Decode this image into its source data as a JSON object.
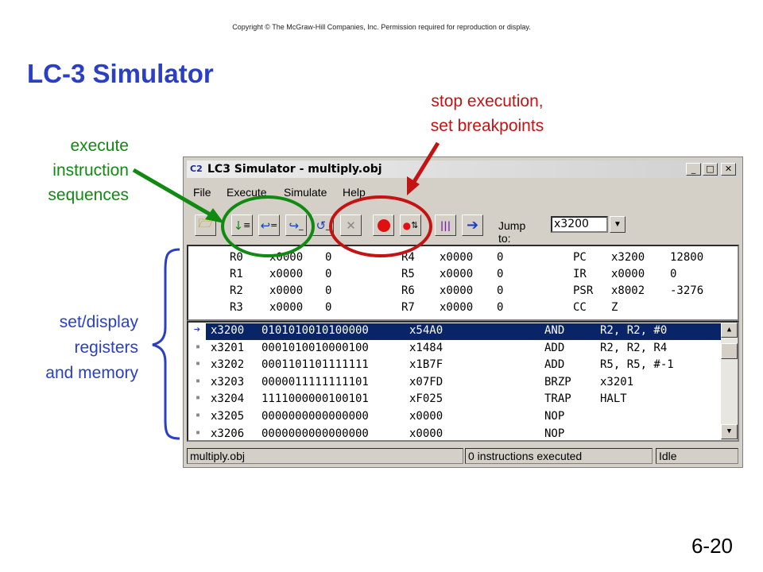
{
  "copyright": "Copyright © The McGraw-Hill Companies, Inc.  Permission required for reproduction or display.",
  "slide_title": "LC-3 Simulator",
  "slide_number": "6-20",
  "annotations": {
    "execute": [
      "execute",
      "instruction",
      "sequences"
    ],
    "stop": [
      "stop execution,",
      "set breakpoints"
    ],
    "display": [
      "set/display",
      "registers",
      "and memory"
    ]
  },
  "colors": {
    "green": "#118a11",
    "red": "#c41313",
    "blue": "#2b3fc4",
    "selection": "#0a2468"
  },
  "window": {
    "icon_text": "C2",
    "title": "LC3 Simulator - multiply.obj",
    "controls": [
      "_",
      "□",
      "✕"
    ],
    "menu": [
      "File",
      "Execute",
      "Simulate",
      "Help"
    ],
    "toolbar_icons": [
      "open-folder-icon",
      "step-over-icon",
      "step-into-icon",
      "step-out-icon",
      "run-icon",
      "clear-icon",
      "stop-icon",
      "breakpoint-icon",
      "registers-icon",
      "arrow-icon"
    ],
    "jump_label": "Jump to:",
    "jump_value": "x3200",
    "registers": [
      [
        {
          "n": "R0",
          "h": "x0000",
          "d": "0"
        },
        {
          "n": "R4",
          "h": "x0000",
          "d": "0"
        },
        {
          "n": "PC",
          "h": "x3200",
          "d": "12800"
        }
      ],
      [
        {
          "n": "R1",
          "h": "x0000",
          "d": "0"
        },
        {
          "n": "R5",
          "h": "x0000",
          "d": "0"
        },
        {
          "n": "IR",
          "h": "x0000",
          "d": "0"
        }
      ],
      [
        {
          "n": "R2",
          "h": "x0000",
          "d": "0"
        },
        {
          "n": "R6",
          "h": "x0000",
          "d": "0"
        },
        {
          "n": "PSR",
          "h": "x8002",
          "d": "-3276"
        }
      ],
      [
        {
          "n": "R3",
          "h": "x0000",
          "d": "0"
        },
        {
          "n": "R7",
          "h": "x0000",
          "d": "0"
        },
        {
          "n": "CC",
          "h": "Z",
          "d": ""
        }
      ]
    ],
    "memory": [
      {
        "addr": "x3200",
        "bin": "0101010010100000",
        "hex": "x54A0",
        "op": "AND",
        "args": "R2, R2, #0",
        "selected": true
      },
      {
        "addr": "x3201",
        "bin": "0001010010000100",
        "hex": "x1484",
        "op": "ADD",
        "args": "R2, R2, R4",
        "selected": false
      },
      {
        "addr": "x3202",
        "bin": "0001101101111111",
        "hex": "x1B7F",
        "op": "ADD",
        "args": "R5, R5, #-1",
        "selected": false
      },
      {
        "addr": "x3203",
        "bin": "0000011111111101",
        "hex": "x07FD",
        "op": "BRZP",
        "args": "x3201",
        "selected": false
      },
      {
        "addr": "x3204",
        "bin": "1111000000100101",
        "hex": "xF025",
        "op": "TRAP",
        "args": "HALT",
        "selected": false
      },
      {
        "addr": "x3205",
        "bin": "0000000000000000",
        "hex": "x0000",
        "op": "NOP",
        "args": "",
        "selected": false
      },
      {
        "addr": "x3206",
        "bin": "0000000000000000",
        "hex": "x0000",
        "op": "NOP",
        "args": "",
        "selected": false
      }
    ],
    "status": [
      "multiply.obj",
      "0 instructions executed",
      "Idle"
    ]
  }
}
